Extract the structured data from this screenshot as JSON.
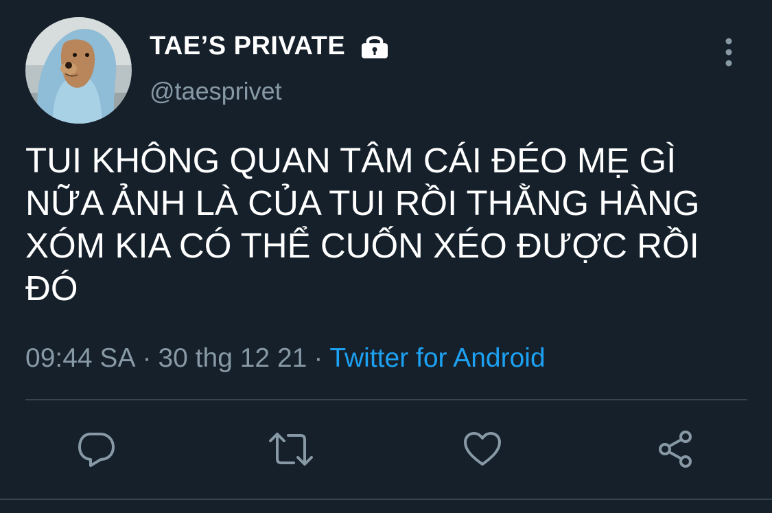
{
  "user": {
    "display_name": "TAE’S PRIVATE",
    "handle": "@taesprivet",
    "avatar_icon": "avatar-dog-hoodie",
    "protected_icon": "lock-icon"
  },
  "tweet": {
    "text": "TUI KHÔNG QUAN TÂM CÁI ĐÉO MẸ GÌ NỮA ẢNH LÀ CỦA TUI RỒI THẰNG HÀNG XÓM KIA CÓ THỂ CUỐN XÉO ĐƯỢC RỒI ĐÓ",
    "time": "09:44 SA",
    "date": "30 thg 12 21",
    "separator": "·",
    "source": "Twitter for Android"
  },
  "actions": {
    "reply_icon": "reply-icon",
    "retweet_icon": "retweet-icon",
    "like_icon": "heart-icon",
    "share_icon": "share-icon"
  },
  "colors": {
    "background": "#15202b",
    "text_primary": "#ffffff",
    "text_secondary": "#8899a6",
    "accent": "#1da1f2",
    "divider": "#38444d"
  }
}
